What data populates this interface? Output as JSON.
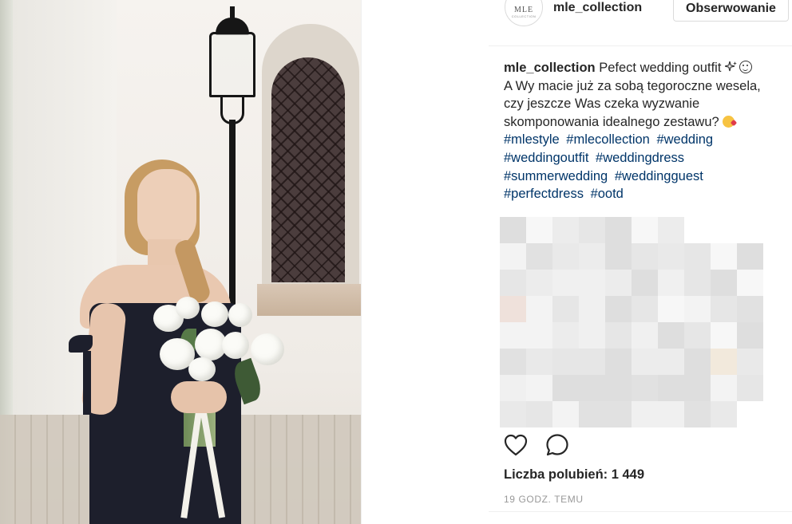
{
  "post": {
    "account": {
      "avatar_text": "MLE",
      "avatar_subtext": "COLLECTION",
      "username": "mle_collection",
      "follow_label": "Obserwowanie"
    },
    "caption": {
      "username": "mle_collection",
      "line1": "Pefect wedding outfit",
      "line2": "A Wy macie już za sobą tegoroczne wesela, czy jeszcze Was czeka wyzwanie skomponowania idealnego zestawu?",
      "hashtags": [
        "#mlestyle",
        "#mlecollection",
        "#wedding",
        "#weddingoutfit",
        "#weddingdress",
        "#summerwedding",
        "#weddingguest",
        "#perfectdress",
        "#ootd"
      ]
    },
    "comments_preview": "...",
    "likes_label": "Liczba polubień: 1 449",
    "time_label": "19 GODZ. TEMU",
    "icons": {
      "like": "heart-icon",
      "comment": "comment-icon",
      "sparkles": "sparkles-emoji",
      "smile": "smile-emoji",
      "kiss": "kiss-emoji"
    },
    "colors": {
      "text": "#262626",
      "hashtag": "#003569",
      "muted": "#999999",
      "border": "#dbdbdb"
    }
  }
}
